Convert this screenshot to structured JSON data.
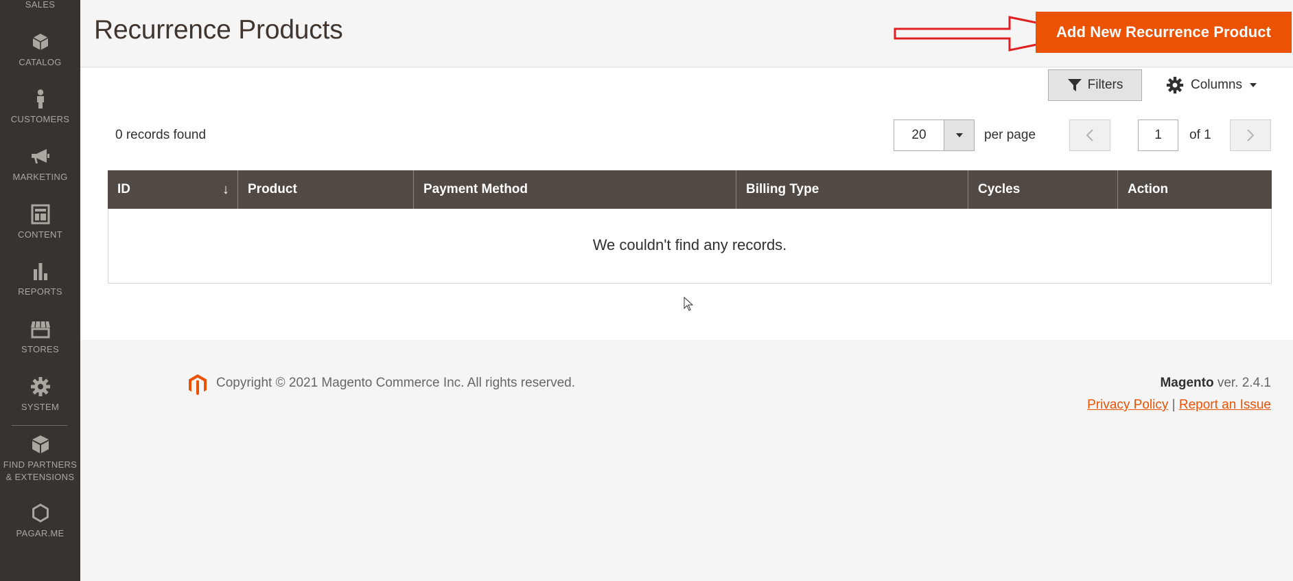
{
  "sidebar": {
    "items": [
      {
        "label": "SALES",
        "icon": "dollar-icon"
      },
      {
        "label": "CATALOG",
        "icon": "cube-icon"
      },
      {
        "label": "CUSTOMERS",
        "icon": "person-icon"
      },
      {
        "label": "MARKETING",
        "icon": "megaphone-icon"
      },
      {
        "label": "CONTENT",
        "icon": "layout-icon"
      },
      {
        "label": "REPORTS",
        "icon": "bar-chart-icon"
      },
      {
        "label": "STORES",
        "icon": "storefront-icon"
      },
      {
        "label": "SYSTEM",
        "icon": "gear-icon"
      },
      {
        "label": "FIND PARTNERS & EXTENSIONS",
        "icon": "blocks-icon"
      },
      {
        "label": "PAGAR.ME",
        "icon": "hexagon-icon"
      }
    ]
  },
  "header": {
    "title": "Recurrence Products",
    "add_button": "Add New Recurrence Product"
  },
  "toolbar": {
    "filters": "Filters",
    "columns": "Columns",
    "records_found": "0 records found",
    "per_page_value": "20",
    "per_page_label": "per page",
    "current_page": "1",
    "page_of": "of 1"
  },
  "grid": {
    "columns": [
      "ID",
      "Product",
      "Payment Method",
      "Billing Type",
      "Cycles",
      "Action"
    ],
    "empty_message": "We couldn't find any records."
  },
  "footer": {
    "copyright": "Copyright © 2021 Magento Commerce Inc. All rights reserved.",
    "brand": "Magento",
    "version": "ver. 2.4.1",
    "privacy": "Privacy Policy",
    "separator": "|",
    "report": "Report an Issue"
  },
  "colors": {
    "accent": "#eb5202",
    "sidebar_bg": "#373330",
    "grid_header": "#514943",
    "annotation_arrow": "#e02020"
  }
}
